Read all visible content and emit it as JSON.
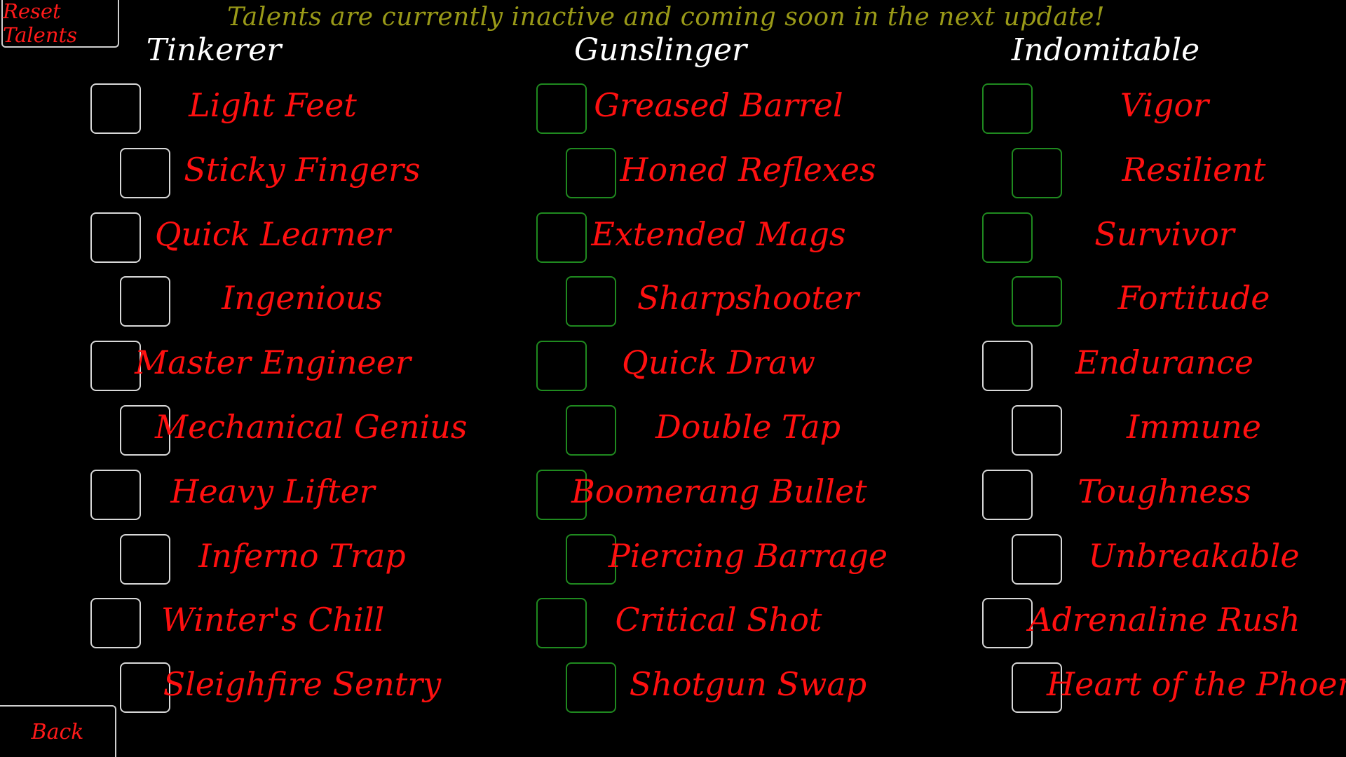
{
  "notice": "Talents are currently inactive and coming soon in the next update!",
  "buttons": {
    "reset": "Reset Talents",
    "back": "Back"
  },
  "columns": [
    {
      "title": "Tinkerer",
      "talents": [
        "Light Feet",
        "Sticky Fingers",
        "Quick Learner",
        "Ingenious",
        "Master Engineer",
        "Mechanical Genius",
        "Heavy Lifter",
        "Inferno Trap",
        "Winter's Chill",
        "Sleighfire Sentry"
      ]
    },
    {
      "title": "Gunslinger",
      "talents": [
        "Greased Barrel",
        "Honed Reflexes",
        "Extended Mags",
        "Sharpshooter",
        "Quick Draw",
        "Double Tap",
        "Boomerang Bullet",
        "Piercing Barrage",
        "Critical Shot",
        "Shotgun Swap"
      ]
    },
    {
      "title": "Indomitable",
      "talents": [
        "Vigor",
        "Resilient",
        "Survivor",
        "Fortitude",
        "Endurance",
        "Immune",
        "Toughness",
        "Unbreakable",
        "Adrenaline Rush",
        "Heart of the Phoenix"
      ]
    }
  ],
  "colors": {
    "talent_text": "#ff1010",
    "notice_text": "#9a9a18",
    "box_default": "#d8d8d8",
    "box_green": "#1f8a1f"
  }
}
